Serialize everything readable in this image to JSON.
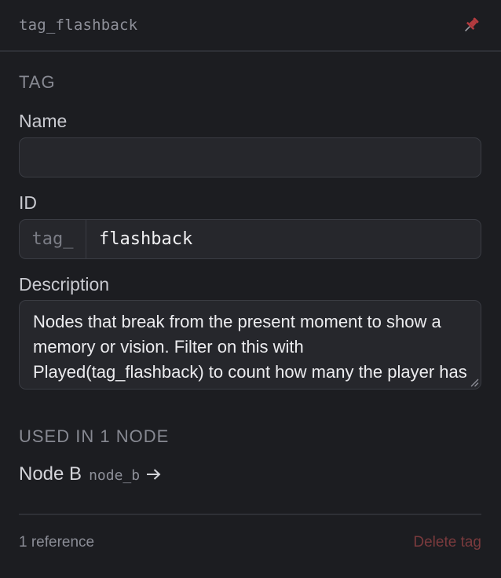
{
  "header": {
    "title": "tag_flashback",
    "pin_icon": "pin-icon"
  },
  "section": {
    "label": "TAG"
  },
  "name_field": {
    "label": "Name",
    "value": ""
  },
  "id_field": {
    "label": "ID",
    "prefix": "tag_",
    "value": "flashback"
  },
  "description_field": {
    "label": "Description",
    "value": "Nodes that break from the present moment to show a memory or vision. Filter on this with Played(tag_flashback) to count how many the player has relived through this run."
  },
  "used_in": {
    "label": "USED IN 1 NODE",
    "nodes": [
      {
        "name": "Node B",
        "id": "node_b",
        "icon": "arrow-right-icon"
      }
    ]
  },
  "footer": {
    "reference_count": "1 reference",
    "delete_label": "Delete tag"
  },
  "colors": {
    "background": "#1c1d21",
    "input_bg": "#26272c",
    "border": "#3a3c43",
    "danger": "#7a3a3d",
    "pin": "#b23b3f"
  }
}
